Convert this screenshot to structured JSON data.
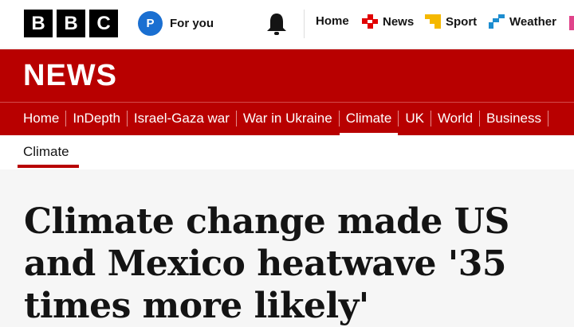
{
  "brand": {
    "letters": [
      "B",
      "B",
      "C"
    ],
    "color": "#000000"
  },
  "for_you": {
    "avatar_letter": "P",
    "label": "For you",
    "accent": "#1a6fd1"
  },
  "top_nav": [
    {
      "label": "Home",
      "icon": ""
    },
    {
      "label": "News",
      "icon": "news-icon",
      "icon_color": "#e10000"
    },
    {
      "label": "Sport",
      "icon": "sport-icon",
      "icon_color": "#f5b800"
    },
    {
      "label": "Weather",
      "icon": "weather-icon",
      "icon_color": "#1d8dd0"
    }
  ],
  "masthead": {
    "title": "NEWS",
    "color": "#b80000"
  },
  "section_nav": [
    "Home",
    "InDepth",
    "Israel-Gaza war",
    "War in Ukraine",
    "Climate",
    "UK",
    "World",
    "Business"
  ],
  "section_nav_active": "Climate",
  "sub_nav": {
    "active": "Climate"
  },
  "article": {
    "headline": "Climate change made US and Mexico heatwave '35 times more likely'"
  }
}
